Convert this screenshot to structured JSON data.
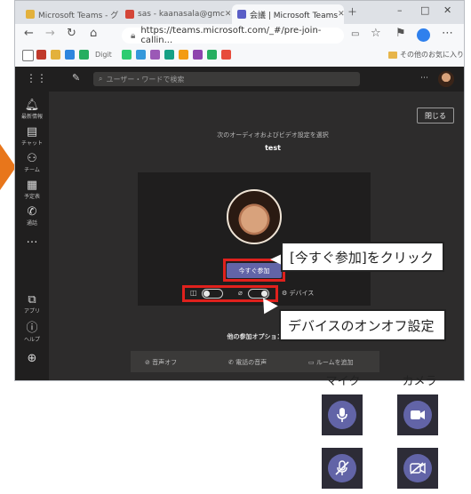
{
  "browser": {
    "tabs": [
      {
        "title": "Microsoft Teams - グル",
        "icon_color": "#e3b13c"
      },
      {
        "title": "sas - kaanasala@gmc",
        "icon_color": "#d44638"
      },
      {
        "title": "会議 | Microsoft Teams",
        "icon_color": "#5b5fc7"
      }
    ],
    "window_controls": [
      "–",
      "□",
      "✕"
    ],
    "url": "https://teams.microsoft.com/_#/pre-join-callin...",
    "bookmarks": [
      "Digit"
    ],
    "bookmark_folder": "その他のお気に入り"
  },
  "teams": {
    "search_placeholder": "ユーザー・ワードで検索",
    "rail": [
      {
        "label": "最新情報",
        "icon": "bell-icon"
      },
      {
        "label": "チャット",
        "icon": "chat-icon"
      },
      {
        "label": "チーム",
        "icon": "teams-icon"
      },
      {
        "label": "予定表",
        "icon": "calendar-icon"
      },
      {
        "label": "通話",
        "icon": "phone-icon"
      },
      {
        "label": "…",
        "icon": "more-icon"
      },
      {
        "label": "アプリ",
        "icon": "apps-icon"
      },
      {
        "label": "ヘルプ",
        "icon": "help-icon"
      }
    ],
    "close_label": "閉じる",
    "prejoin_title": "次のオーディオおよびビデオ設定を選択",
    "meeting_name": "test",
    "join_label": "今すぐ参加",
    "devices_label": "デバイス",
    "other_options_title": "他の参加オプション",
    "options": [
      "音声オフ",
      "電話の音声",
      "ルームを追加"
    ]
  },
  "callouts": {
    "join": "[今すぐ参加]をクリック",
    "devices": "デバイスのオンオフ設定"
  },
  "legend": {
    "mic_label": "マイク",
    "camera_label": "カメラ"
  },
  "colors": {
    "teams_purple": "#6264a7",
    "highlight_red": "#e0211d",
    "accent_orange": "#e8761b"
  }
}
